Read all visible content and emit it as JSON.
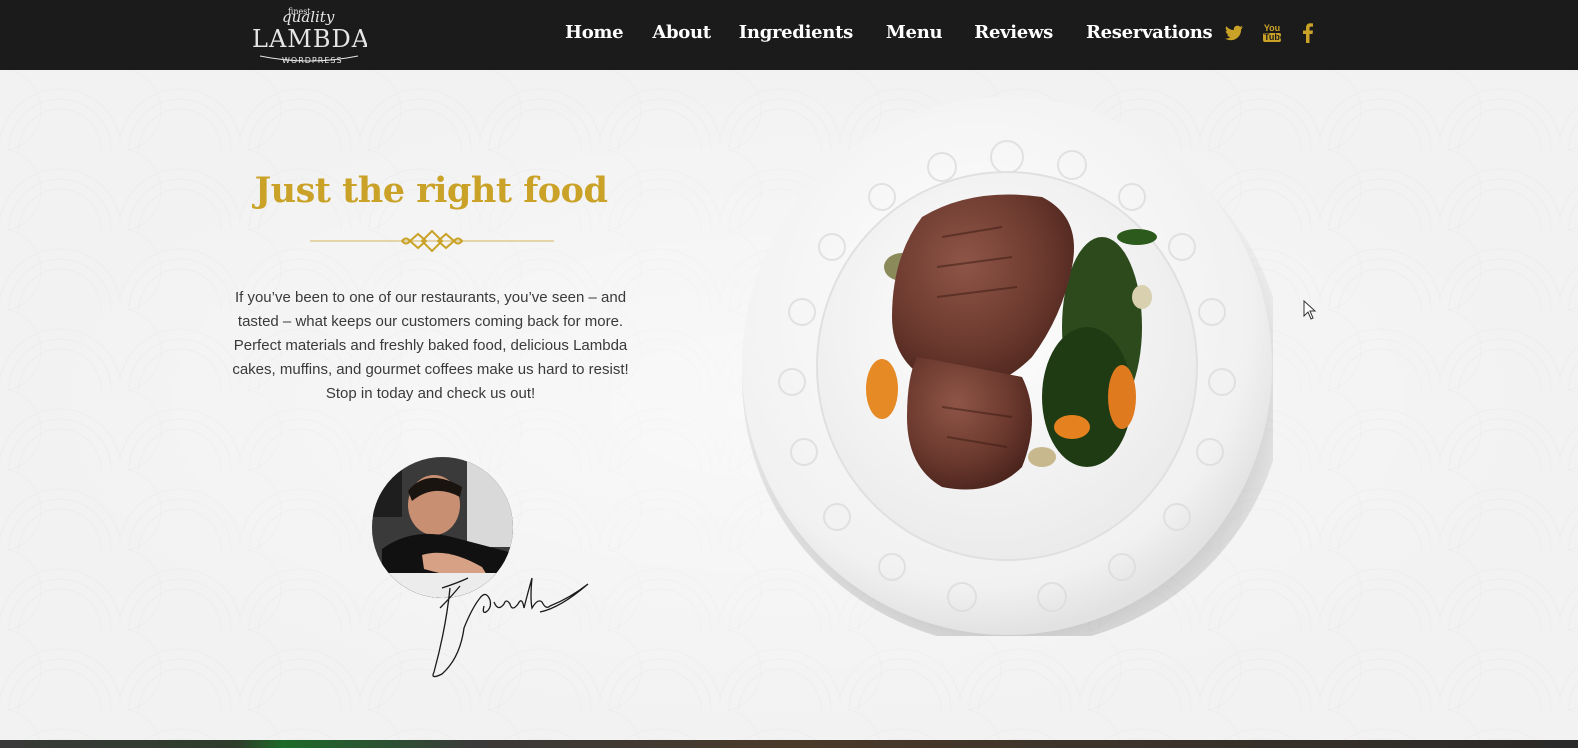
{
  "logo": {
    "top_text": "finest",
    "script_text": "quality",
    "brand": "LAMBDA",
    "sub": "WORDPRESS"
  },
  "nav": {
    "items": [
      "Home",
      "About",
      "Ingredients",
      "Menu",
      "Reviews",
      "Reservations"
    ]
  },
  "social": {
    "icons": [
      "twitter-icon",
      "youtube-icon",
      "facebook-icon"
    ],
    "youtube_label_top": "You",
    "youtube_label_bottom": "Tube"
  },
  "hero": {
    "title": "Just the right food",
    "body": "If you’ve been to one of our restaurants, you’ve seen – and tasted – what keeps our customers coming back for more. Perfect materials and freshly baked food, delicious Lambda cakes, muffins, and gourmet coffees make us hard to resist! Stop in today and check us out!"
  },
  "colors": {
    "accent": "#c9a227",
    "topbar": "#1b1b1b",
    "nav_text": "#ffffff",
    "body_text": "#3a3a3a",
    "background": "#f2f2f2"
  }
}
